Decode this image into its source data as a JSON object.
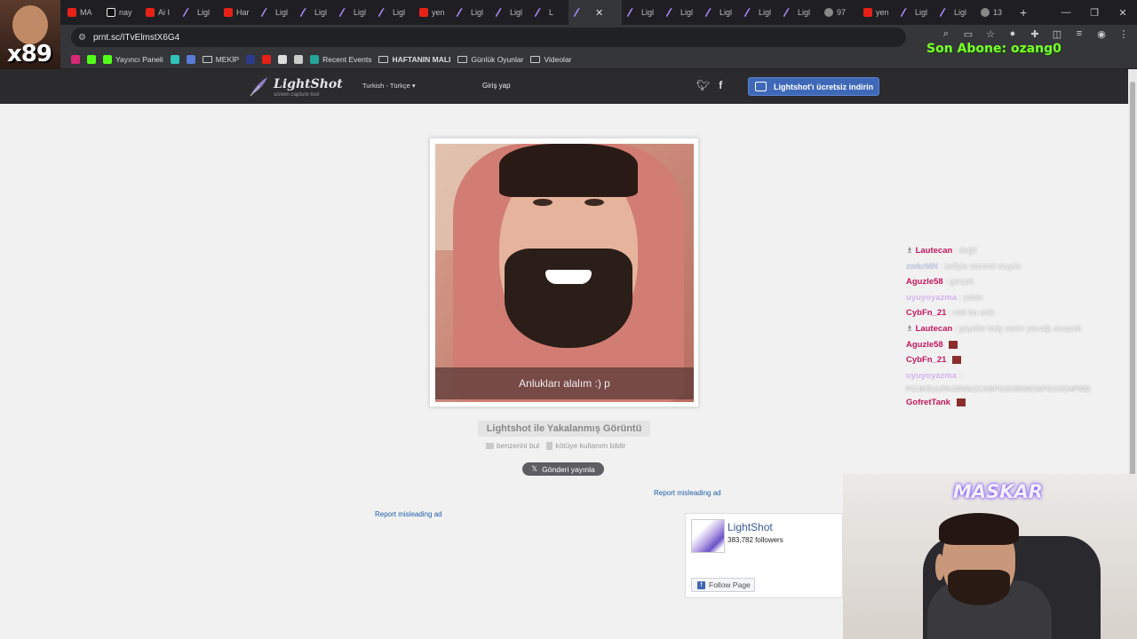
{
  "browser": {
    "tabs": [
      {
        "label": "MA",
        "icon": "youtube-icon"
      },
      {
        "label": "nay",
        "icon": "tiktok-icon"
      },
      {
        "label": "Ai I",
        "icon": "youtube-icon"
      },
      {
        "label": "Ligl",
        "icon": "lightshot-icon"
      },
      {
        "label": "Har",
        "icon": "youtube-icon"
      },
      {
        "label": "Ligl",
        "icon": "lightshot-icon"
      },
      {
        "label": "Ligl",
        "icon": "lightshot-icon"
      },
      {
        "label": "Ligl",
        "icon": "lightshot-icon"
      },
      {
        "label": "Ligl",
        "icon": "lightshot-icon"
      },
      {
        "label": "yen",
        "icon": "youtube-icon"
      },
      {
        "label": "Ligl",
        "icon": "lightshot-icon"
      },
      {
        "label": "Ligl",
        "icon": "lightshot-icon"
      },
      {
        "label": "L",
        "icon": "lightshot-icon"
      },
      {
        "label": "",
        "icon": "lightshot-icon",
        "active": true
      },
      {
        "label": "Ligl",
        "icon": "lightshot-icon"
      },
      {
        "label": "Ligl",
        "icon": "lightshot-icon"
      },
      {
        "label": "Ligl",
        "icon": "lightshot-icon"
      },
      {
        "label": "Ligl",
        "icon": "lightshot-icon"
      },
      {
        "label": "Ligl",
        "icon": "lightshot-icon"
      },
      {
        "label": "97",
        "icon": "globe-icon"
      },
      {
        "label": "yen",
        "icon": "youtube-icon"
      },
      {
        "label": "Ligl",
        "icon": "lightshot-icon"
      },
      {
        "label": "Ligl",
        "icon": "lightshot-icon"
      },
      {
        "label": "13",
        "icon": "globe-icon"
      }
    ],
    "url": "prnt.sc/ITvElmstX6G4",
    "bookmarks": [
      {
        "label": "",
        "icon": "instagram-icon",
        "color": "#d62976"
      },
      {
        "label": "",
        "icon": "kick-icon",
        "color": "#53fc18"
      },
      {
        "label": "Yayıncı Paneli",
        "icon": "kick-icon",
        "color": "#53fc18"
      },
      {
        "label": "",
        "icon": "app-icon",
        "color": "#2ec4b6"
      },
      {
        "label": "",
        "icon": "arrow-icon",
        "color": "#5a7bd5"
      },
      {
        "label": "MEKİP",
        "icon": "folder-icon"
      },
      {
        "label": "",
        "icon": "app-icon",
        "color": "#2b3a8a"
      },
      {
        "label": "",
        "icon": "youtube-icon",
        "color": "#e62117"
      },
      {
        "label": "",
        "icon": "image-icon",
        "color": "#dddddd"
      },
      {
        "label": "",
        "icon": "openai-icon",
        "color": "#cccccc"
      },
      {
        "label": "Recent Events",
        "icon": "streamelements-icon",
        "color": "#26a69a"
      },
      {
        "label": "HAFTANIN MALI",
        "icon": "folder-icon"
      },
      {
        "label": "Günlük Oyunlar",
        "icon": "folder-icon"
      },
      {
        "label": "Videolar",
        "icon": "folder-icon"
      }
    ]
  },
  "overlay": {
    "badge": "x89",
    "subscriber_banner": "Son Abone: ozang0",
    "webcam_title": "MASKAR"
  },
  "site": {
    "logo_name": "LightShot",
    "logo_tagline": "screen capture tool",
    "language": "Turkish - Türkçe",
    "login": "Giriş yap",
    "download_button": "Lightshot'ı ücretsiz indirin"
  },
  "screenshot": {
    "caption": "Anlukları alalım :) p",
    "title": "Lightshot ile Yakalanmış Görüntü",
    "find_similar": "benzerini bul",
    "report_abuse": "kötüye kullanım bildir",
    "post_button": "Gönderi yayınla"
  },
  "ads": {
    "report_misleading_1": "Report misleading ad",
    "report_misleading_2": "Report misleading ad"
  },
  "facebook": {
    "page_name": "LightShot",
    "followers": "383,782 followers",
    "follow_button": "Follow Page"
  },
  "chat": [
    {
      "user": "Lautecan",
      "msg": ": değil",
      "color": "u-red",
      "pin": true
    },
    {
      "user": "zwkrMN",
      "msg": ": tedlyle samimi oluyon",
      "color": "u-ghost"
    },
    {
      "user": "Aguzle58",
      "msg": ": gerçek",
      "color": "u-red"
    },
    {
      "user": "uyuyoyazma",
      "msg": ": yalan",
      "color": "u-lilac"
    },
    {
      "user": "CybFn_21",
      "msg": ": reel bu anlk",
      "color": "u-red"
    },
    {
      "user": "Lautecan",
      "msg": ": gayette tedy senin yarrağı avuçadı",
      "color": "u-red",
      "pin": true
    },
    {
      "user": "Aguzle58",
      "msg": "",
      "color": "u-red",
      "emote": true
    },
    {
      "user": "CybFn_21",
      "msg": "",
      "color": "u-red",
      "emote": true
    },
    {
      "user": "uyuyoyazma",
      "msg": ":",
      "color": "u-lilac"
    },
    {
      "user": "GofretTank",
      "msg": "",
      "color": "u-red",
      "emote": true
    }
  ],
  "chat_continuation": "POJKSUUPAJ3WKOCAGPOJOSKMOAPGOJOAPWD"
}
